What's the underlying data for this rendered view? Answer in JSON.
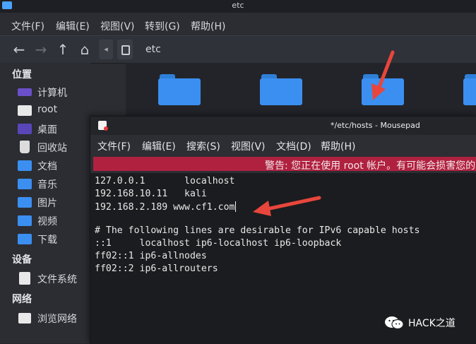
{
  "file_manager": {
    "title": "etc",
    "menu": [
      "文件(F)",
      "编辑(E)",
      "视图(V)",
      "转到(G)",
      "帮助(H)"
    ],
    "path": "etc",
    "sidebar": {
      "places_header": "位置",
      "places": [
        {
          "label": "计算机",
          "icon": "computer-icon"
        },
        {
          "label": "root",
          "icon": "home-folder-icon"
        },
        {
          "label": "桌面",
          "icon": "desktop-icon"
        },
        {
          "label": "回收站",
          "icon": "trash-icon"
        },
        {
          "label": "文档",
          "icon": "documents-folder-icon"
        },
        {
          "label": "音乐",
          "icon": "music-folder-icon"
        },
        {
          "label": "图片",
          "icon": "pictures-folder-icon"
        },
        {
          "label": "视频",
          "icon": "videos-folder-icon"
        },
        {
          "label": "下载",
          "icon": "downloads-folder-icon"
        }
      ],
      "devices_header": "设备",
      "devices": [
        {
          "label": "文件系统",
          "icon": "filesystem-icon"
        }
      ],
      "network_header": "网络",
      "network": [
        {
          "label": "浏览网络",
          "icon": "network-icon"
        }
      ]
    }
  },
  "editor": {
    "title": "*/etc/hosts - Mousepad",
    "menu": [
      "文件(F)",
      "编辑(E)",
      "搜索(S)",
      "视图(V)",
      "文档(D)",
      "帮助(H)"
    ],
    "warning": "警告: 您正在使用 root 帐户。有可能会损害您的",
    "lines": [
      "127.0.0.1       localhost",
      "192.168.10.11   kali",
      "192.168.2.189 www.cf1.com",
      "",
      "# The following lines are desirable for IPv6 capable hosts",
      "::1     localhost ip6-localhost ip6-loopback",
      "ff02::1 ip6-allnodes",
      "ff02::2 ip6-allrouters"
    ]
  },
  "watermark": "HACK之道",
  "colors": {
    "warning_bg": "#b0213f",
    "folder": "#3b8ff0",
    "arrow": "#e8463c"
  }
}
